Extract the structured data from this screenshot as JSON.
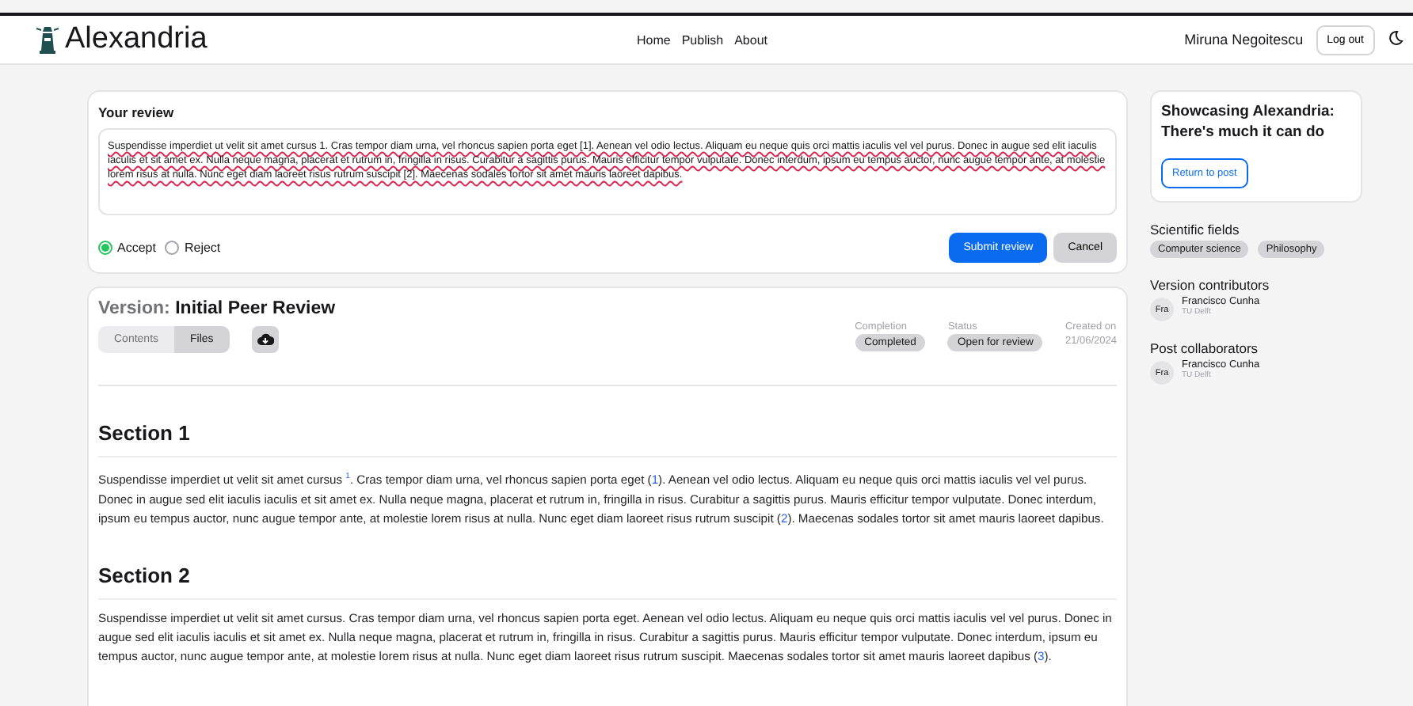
{
  "header": {
    "brand": "Alexandria",
    "nav": [
      {
        "label": "Home"
      },
      {
        "label": "Publish"
      },
      {
        "label": "About"
      }
    ],
    "user": "Miruna Negoitescu",
    "logout": "Log out"
  },
  "review": {
    "title": "Your review",
    "value": "Suspendisse imperdiet ut velit sit amet cursus 1. Cras tempor diam urna, vel rhoncus sapien porta eget [1]. Aenean vel odio lectus. Aliquam eu neque quis orci mattis iaculis vel vel purus. Donec in augue sed elit iaculis iaculis et sit amet ex. Nulla neque magna, placerat et rutrum in, fringilla in risus. Curabitur a sagittis purus. Mauris efficitur tempor vulputate. Donec interdum, ipsum eu tempus auctor, nunc augue tempor ante, at molestie lorem risus at nulla. Nunc eget diam laoreet risus rutrum suscipit [2]. Maecenas sodales tortor sit amet mauris laoreet dapibus.",
    "options": [
      {
        "label": "Accept",
        "selected": true
      },
      {
        "label": "Reject",
        "selected": false
      }
    ],
    "submit": "Submit review",
    "cancel": "Cancel"
  },
  "version": {
    "label": "Version:",
    "name": "Initial Peer Review",
    "tabs": [
      {
        "label": "Contents",
        "selected": false
      },
      {
        "label": "Files",
        "selected": true
      }
    ],
    "meta": [
      {
        "label": "Completion",
        "kind": "badge",
        "value": "Completed"
      },
      {
        "label": "Status",
        "kind": "badge",
        "value": "Open for review"
      },
      {
        "label": "Created on",
        "kind": "plain",
        "value": "21/06/2024"
      }
    ],
    "sections": [
      {
        "heading": "Section 1",
        "paragraph": [
          {
            "kind": "text",
            "text": "Suspendisse imperdiet ut velit sit amet cursus "
          },
          {
            "kind": "sup",
            "text": "1"
          },
          {
            "kind": "text",
            "text": ". Cras tempor diam urna, vel rhoncus sapien porta eget ("
          },
          {
            "kind": "ref",
            "text": "1"
          },
          {
            "kind": "text",
            "text": "). Aenean vel odio lectus. Aliquam eu neque quis orci mattis iaculis vel vel purus. Donec in augue sed elit iaculis iaculis et sit amet ex. Nulla neque magna, placerat et rutrum in, fringilla in risus. Curabitur a sagittis purus. Mauris efficitur tempor vulputate. Donec interdum, ipsum eu tempus auctor, nunc augue tempor ante, at molestie lorem risus at nulla. Nunc eget diam laoreet risus rutrum suscipit ("
          },
          {
            "kind": "ref",
            "text": "2"
          },
          {
            "kind": "text",
            "text": "). Maecenas sodales tortor sit amet mauris laoreet dapibus."
          }
        ]
      },
      {
        "heading": "Section 2",
        "paragraph": [
          {
            "kind": "text",
            "text": "Suspendisse imperdiet ut velit sit amet cursus. Cras tempor diam urna, vel rhoncus sapien porta eget. Aenean vel odio lectus. Aliquam eu neque quis orci mattis iaculis vel vel purus. Donec in augue sed elit iaculis iaculis et sit amet ex. Nulla neque magna, placerat et rutrum in, fringilla in risus. Curabitur a sagittis purus. Mauris efficitur tempor vulputate. Donec interdum, ipsum eu tempus auctor, nunc augue tempor ante, at molestie lorem risus at nulla. Nunc eget diam laoreet risus rutrum suscipit. Maecenas sodales tortor sit amet mauris laoreet dapibus ("
          },
          {
            "kind": "ref",
            "text": "3"
          },
          {
            "kind": "text",
            "text": ")."
          }
        ]
      }
    ]
  },
  "sidebar": {
    "post_title": "Showcasing Alexandria: There's much it can do",
    "return": "Return to post",
    "fields_title": "Scientific fields",
    "fields": [
      "Computer science",
      "Philosophy"
    ],
    "groups": [
      {
        "title": "Version contributors",
        "people": [
          {
            "initials": "Fra",
            "name": "Francisco Cunha",
            "affiliation": "TU Delft"
          }
        ]
      },
      {
        "title": "Post collaborators",
        "people": [
          {
            "initials": "Fra",
            "name": "Francisco Cunha",
            "affiliation": "TU Delft"
          }
        ]
      }
    ]
  }
}
